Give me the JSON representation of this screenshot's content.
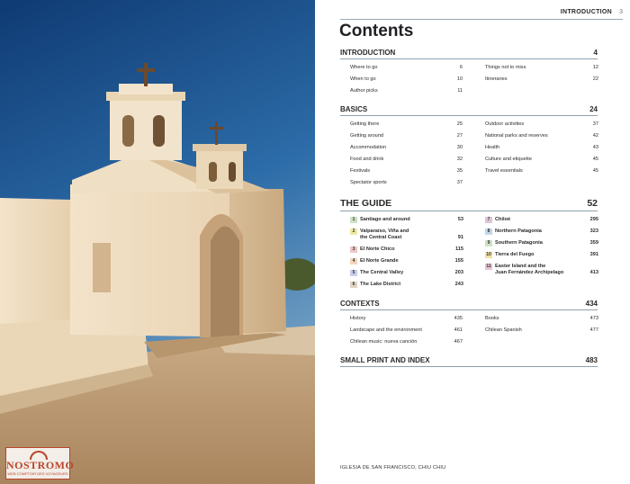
{
  "photo": {
    "description_icon": "church-photo"
  },
  "logo": {
    "name": "NOSTROMO",
    "tagline": "WEB COMPTOIR DES VOYAGEURS"
  },
  "running_head": {
    "title": "INTRODUCTION",
    "page": "3"
  },
  "contents_title": "Contents",
  "sections": {
    "introduction": {
      "title": "INTRODUCTION",
      "page": "4",
      "left": [
        {
          "label": "Where to go",
          "page": "6"
        },
        {
          "label": "When to go",
          "page": "10"
        },
        {
          "label": "Author picks",
          "page": "11"
        }
      ],
      "right": [
        {
          "label": "Things not to miss",
          "page": "12"
        },
        {
          "label": "Itineraries",
          "page": "22"
        }
      ]
    },
    "basics": {
      "title": "BASICS",
      "page": "24",
      "left": [
        {
          "label": "Getting there",
          "page": "25"
        },
        {
          "label": "Getting around",
          "page": "27"
        },
        {
          "label": "Accommodation",
          "page": "30"
        },
        {
          "label": "Food and drink",
          "page": "32"
        },
        {
          "label": "Festivals",
          "page": "35"
        },
        {
          "label": "Spectator sports",
          "page": "37"
        }
      ],
      "right": [
        {
          "label": "Outdoor activities",
          "page": "37"
        },
        {
          "label": "National parks and reserves",
          "page": "42"
        },
        {
          "label": "Health",
          "page": "43"
        },
        {
          "label": "Culture and etiquette",
          "page": "45"
        },
        {
          "label": "Travel essentials",
          "page": "45"
        }
      ]
    },
    "guide": {
      "title": "THE GUIDE",
      "page": "52",
      "left": [
        {
          "num": "1",
          "line1": "Santiago and around",
          "line2": "",
          "page": "53",
          "color": "#cfe0c4"
        },
        {
          "num": "2",
          "line1": "Valparaíso, Viña and",
          "line2": "the Central Coast",
          "page": "91",
          "color": "#f1e7a6"
        },
        {
          "num": "3",
          "line1": "El Norte Chico",
          "line2": "",
          "page": "115",
          "color": "#efc6c6"
        },
        {
          "num": "4",
          "line1": "El Norte Grande",
          "line2": "",
          "page": "155",
          "color": "#f2d6bf"
        },
        {
          "num": "5",
          "line1": "The Central Valley",
          "line2": "",
          "page": "203",
          "color": "#c9cde8"
        },
        {
          "num": "6",
          "line1": "The Lake District",
          "line2": "",
          "page": "243",
          "color": "#ded4c4"
        }
      ],
      "right": [
        {
          "num": "7",
          "line1": "Chiloé",
          "line2": "",
          "page": "295",
          "color": "#ddc6d8"
        },
        {
          "num": "8",
          "line1": "Northern Patagonia",
          "line2": "",
          "page": "323",
          "color": "#c4d7e6"
        },
        {
          "num": "9",
          "line1": "Southern Patagonia",
          "line2": "",
          "page": "359",
          "color": "#cde2c4"
        },
        {
          "num": "10",
          "line1": "Tierra del Fuego",
          "line2": "",
          "page": "391",
          "color": "#f2e0a2"
        },
        {
          "num": "11",
          "line1": "Easter Island and the",
          "line2": "Juan Fernández Archipelago",
          "page": "413",
          "color": "#e6c3d4"
        }
      ]
    },
    "contexts": {
      "title": "CONTEXTS",
      "page": "434",
      "left": [
        {
          "label": "History",
          "page": "435"
        },
        {
          "label": "Landscape and the environment",
          "page": "461"
        },
        {
          "label": "Chilean music: nueva canción",
          "page": "467"
        }
      ],
      "right": [
        {
          "label": "Books",
          "page": "473"
        },
        {
          "label": "Chilean Spanish",
          "page": "477"
        }
      ]
    },
    "small_print": {
      "title": "SMALL PRINT AND INDEX",
      "page": "483"
    }
  },
  "caption": "IGLESIA DE SAN FRANCISCO, CHIU CHIU"
}
